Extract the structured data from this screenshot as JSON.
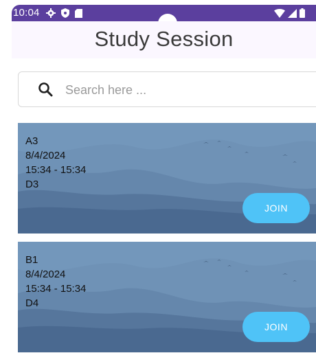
{
  "status_bar": {
    "time": "10:04"
  },
  "app_bar": {
    "title": "Study Session"
  },
  "search": {
    "placeholder": "Search here ...",
    "value": ""
  },
  "sessions": [
    {
      "name": "A3",
      "date": "8/4/2024",
      "time": "15:34 - 15:34",
      "room": "D3",
      "button_label": "JOIN"
    },
    {
      "name": "B1",
      "date": "8/4/2024",
      "time": "15:34 - 15:34",
      "room": "D4",
      "button_label": "JOIN"
    }
  ],
  "colors": {
    "status_bar": "#5b3f9e",
    "app_bar": "#fbf7ff",
    "join_button": "#4fc3f7",
    "card_background": "#6f93b7"
  },
  "icons": {
    "status_left": [
      "settings-icon",
      "shield-icon",
      "sd-card-icon"
    ],
    "status_right": [
      "wifi-icon",
      "signal-icon",
      "battery-icon"
    ],
    "search": "search-icon"
  }
}
